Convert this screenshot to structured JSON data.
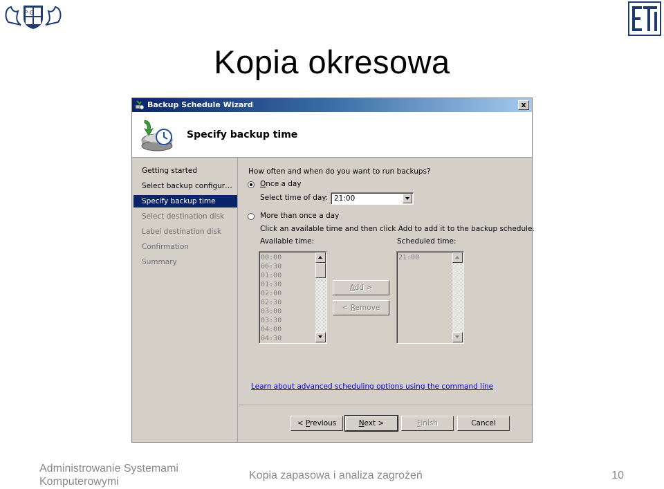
{
  "slide": {
    "title": "Kopia okresowa",
    "footer_left": "Administrowanie Systemami Komputerowymi",
    "footer_center": "Kopia zapasowa i analiza zagrożeń",
    "page_number": "10",
    "logo_left_letters": "P G",
    "logo_right_text": "ETI"
  },
  "wizard": {
    "window_title": "Backup Schedule Wizard",
    "close_label": "x",
    "header_title": "Specify backup time",
    "nav_items": [
      {
        "label": "Getting started",
        "state": "done"
      },
      {
        "label": "Select backup configur…",
        "state": "done"
      },
      {
        "label": "Specify backup time",
        "state": "active"
      },
      {
        "label": "Select destination disk",
        "state": "disabled"
      },
      {
        "label": "Label destination disk",
        "state": "disabled"
      },
      {
        "label": "Confirmation",
        "state": "disabled"
      },
      {
        "label": "Summary",
        "state": "disabled"
      }
    ],
    "question": "How often and when do you want to run backups?",
    "once_a_day": {
      "label": "Once a day",
      "selected": true
    },
    "select_time_label": "Select time of day:",
    "select_time_value": "21:00",
    "more_than_once": {
      "label": "More than once a day",
      "selected": false
    },
    "instruction": "Click an available time and then click Add to add it to the backup schedule.",
    "available_label": "Available time:",
    "available_times": [
      "00:00",
      "00:30",
      "01:00",
      "01:30",
      "02:00",
      "02:30",
      "03:00",
      "03:30",
      "04:00",
      "04:30"
    ],
    "scheduled_label": "Scheduled time:",
    "scheduled_times": [
      "21:00"
    ],
    "add_label": "Add >",
    "remove_label": "< Remove",
    "link_text": "Learn about advanced scheduling options using the command line",
    "buttons": {
      "previous": "< Previous",
      "next": "Next >",
      "finish": "Finish",
      "cancel": "Cancel"
    },
    "colors": {
      "titlebar_start": "#0a246a",
      "titlebar_end": "#a6caf0",
      "selection": "#0a246a",
      "window_face": "#d4d0c8",
      "link": "#0000cc"
    }
  }
}
